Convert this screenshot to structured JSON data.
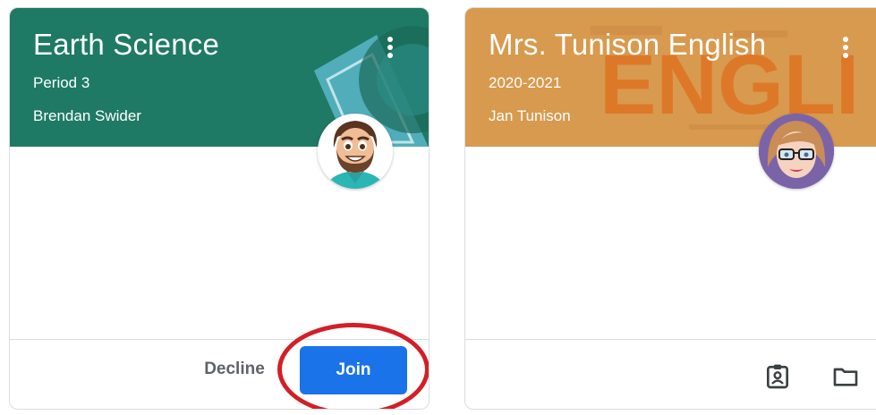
{
  "cards": [
    {
      "title": "Earth Science",
      "subtitle": "Period 3",
      "teacher": "Brendan Swider",
      "color": "#1e7a64",
      "actions": {
        "decline_label": "Decline",
        "join_label": "Join"
      },
      "icons": {
        "menu": "more-vert-icon",
        "avatar": "teacher-avatar"
      }
    },
    {
      "title": "Mrs. Tunison English",
      "subtitle": "2020-2021",
      "teacher": "Jan Tunison",
      "color": "#d89a4e",
      "banner_text": "ENGLI",
      "icons": {
        "menu": "more-vert-icon",
        "avatar": "teacher-avatar",
        "footer": [
          "assignment-ind-icon",
          "folder-icon"
        ]
      }
    }
  ],
  "accent_colors": {
    "join_button": "#1a73e8",
    "highlight_ring": "#d31f26"
  }
}
